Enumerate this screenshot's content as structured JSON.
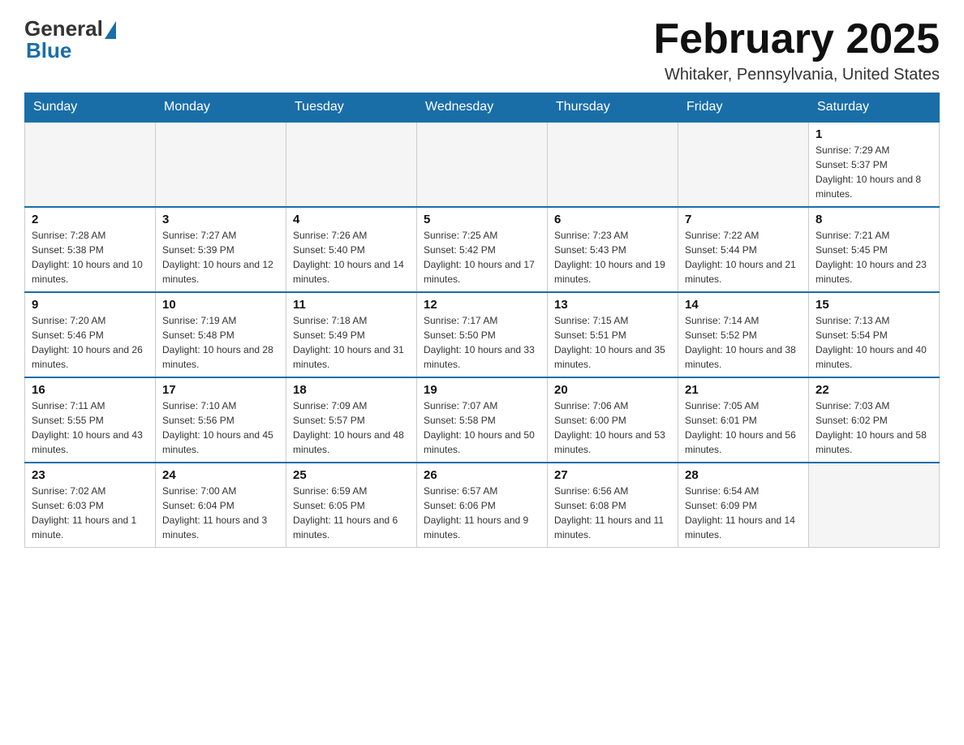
{
  "header": {
    "logo_general": "General",
    "logo_blue": "Blue",
    "month_title": "February 2025",
    "location": "Whitaker, Pennsylvania, United States"
  },
  "days_of_week": [
    "Sunday",
    "Monday",
    "Tuesday",
    "Wednesday",
    "Thursday",
    "Friday",
    "Saturday"
  ],
  "weeks": [
    [
      {
        "day": "",
        "info": ""
      },
      {
        "day": "",
        "info": ""
      },
      {
        "day": "",
        "info": ""
      },
      {
        "day": "",
        "info": ""
      },
      {
        "day": "",
        "info": ""
      },
      {
        "day": "",
        "info": ""
      },
      {
        "day": "1",
        "info": "Sunrise: 7:29 AM\nSunset: 5:37 PM\nDaylight: 10 hours and 8 minutes."
      }
    ],
    [
      {
        "day": "2",
        "info": "Sunrise: 7:28 AM\nSunset: 5:38 PM\nDaylight: 10 hours and 10 minutes."
      },
      {
        "day": "3",
        "info": "Sunrise: 7:27 AM\nSunset: 5:39 PM\nDaylight: 10 hours and 12 minutes."
      },
      {
        "day": "4",
        "info": "Sunrise: 7:26 AM\nSunset: 5:40 PM\nDaylight: 10 hours and 14 minutes."
      },
      {
        "day": "5",
        "info": "Sunrise: 7:25 AM\nSunset: 5:42 PM\nDaylight: 10 hours and 17 minutes."
      },
      {
        "day": "6",
        "info": "Sunrise: 7:23 AM\nSunset: 5:43 PM\nDaylight: 10 hours and 19 minutes."
      },
      {
        "day": "7",
        "info": "Sunrise: 7:22 AM\nSunset: 5:44 PM\nDaylight: 10 hours and 21 minutes."
      },
      {
        "day": "8",
        "info": "Sunrise: 7:21 AM\nSunset: 5:45 PM\nDaylight: 10 hours and 23 minutes."
      }
    ],
    [
      {
        "day": "9",
        "info": "Sunrise: 7:20 AM\nSunset: 5:46 PM\nDaylight: 10 hours and 26 minutes."
      },
      {
        "day": "10",
        "info": "Sunrise: 7:19 AM\nSunset: 5:48 PM\nDaylight: 10 hours and 28 minutes."
      },
      {
        "day": "11",
        "info": "Sunrise: 7:18 AM\nSunset: 5:49 PM\nDaylight: 10 hours and 31 minutes."
      },
      {
        "day": "12",
        "info": "Sunrise: 7:17 AM\nSunset: 5:50 PM\nDaylight: 10 hours and 33 minutes."
      },
      {
        "day": "13",
        "info": "Sunrise: 7:15 AM\nSunset: 5:51 PM\nDaylight: 10 hours and 35 minutes."
      },
      {
        "day": "14",
        "info": "Sunrise: 7:14 AM\nSunset: 5:52 PM\nDaylight: 10 hours and 38 minutes."
      },
      {
        "day": "15",
        "info": "Sunrise: 7:13 AM\nSunset: 5:54 PM\nDaylight: 10 hours and 40 minutes."
      }
    ],
    [
      {
        "day": "16",
        "info": "Sunrise: 7:11 AM\nSunset: 5:55 PM\nDaylight: 10 hours and 43 minutes."
      },
      {
        "day": "17",
        "info": "Sunrise: 7:10 AM\nSunset: 5:56 PM\nDaylight: 10 hours and 45 minutes."
      },
      {
        "day": "18",
        "info": "Sunrise: 7:09 AM\nSunset: 5:57 PM\nDaylight: 10 hours and 48 minutes."
      },
      {
        "day": "19",
        "info": "Sunrise: 7:07 AM\nSunset: 5:58 PM\nDaylight: 10 hours and 50 minutes."
      },
      {
        "day": "20",
        "info": "Sunrise: 7:06 AM\nSunset: 6:00 PM\nDaylight: 10 hours and 53 minutes."
      },
      {
        "day": "21",
        "info": "Sunrise: 7:05 AM\nSunset: 6:01 PM\nDaylight: 10 hours and 56 minutes."
      },
      {
        "day": "22",
        "info": "Sunrise: 7:03 AM\nSunset: 6:02 PM\nDaylight: 10 hours and 58 minutes."
      }
    ],
    [
      {
        "day": "23",
        "info": "Sunrise: 7:02 AM\nSunset: 6:03 PM\nDaylight: 11 hours and 1 minute."
      },
      {
        "day": "24",
        "info": "Sunrise: 7:00 AM\nSunset: 6:04 PM\nDaylight: 11 hours and 3 minutes."
      },
      {
        "day": "25",
        "info": "Sunrise: 6:59 AM\nSunset: 6:05 PM\nDaylight: 11 hours and 6 minutes."
      },
      {
        "day": "26",
        "info": "Sunrise: 6:57 AM\nSunset: 6:06 PM\nDaylight: 11 hours and 9 minutes."
      },
      {
        "day": "27",
        "info": "Sunrise: 6:56 AM\nSunset: 6:08 PM\nDaylight: 11 hours and 11 minutes."
      },
      {
        "day": "28",
        "info": "Sunrise: 6:54 AM\nSunset: 6:09 PM\nDaylight: 11 hours and 14 minutes."
      },
      {
        "day": "",
        "info": ""
      }
    ]
  ]
}
